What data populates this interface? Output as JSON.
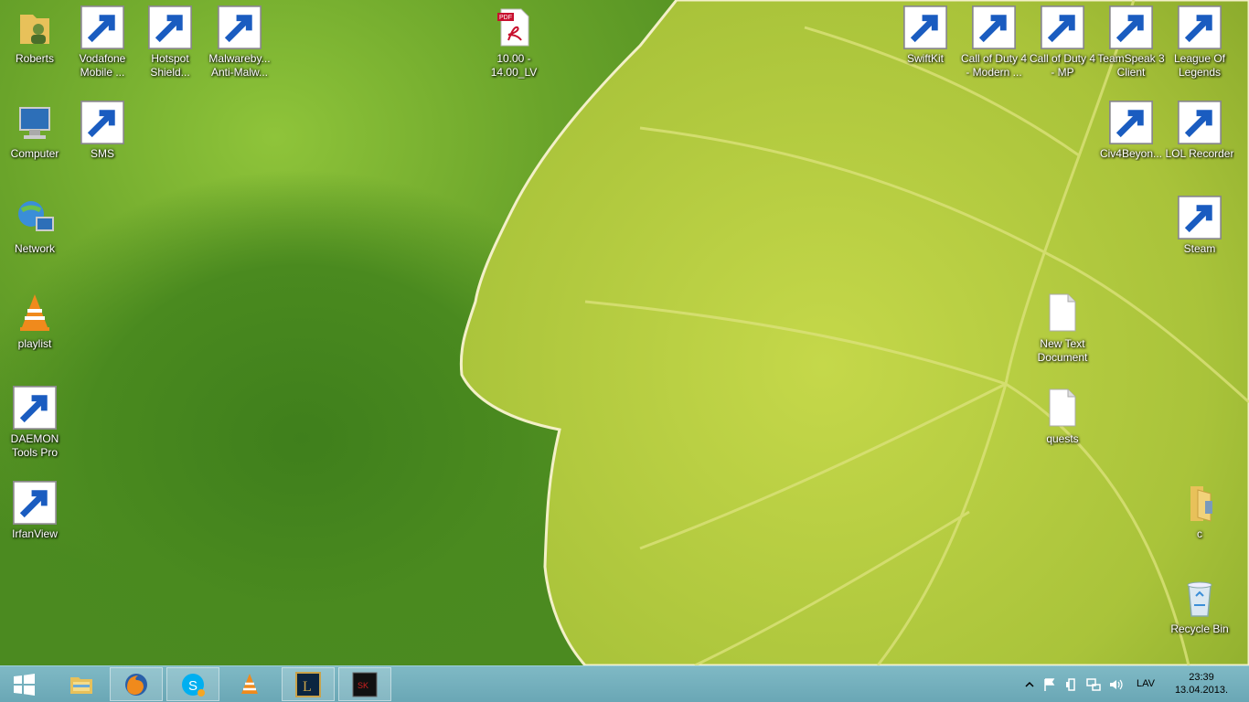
{
  "desktop_icons": [
    {
      "label": "Roberts",
      "icon": "user-folder-icon"
    },
    {
      "label": "Vodafone\nMobile ...",
      "icon": "vodafone-icon"
    },
    {
      "label": "Hotspot\nShield...",
      "icon": "hotspot-shield-icon"
    },
    {
      "label": "Malwareby...\nAnti-Malw...",
      "icon": "malwarebytes-icon"
    },
    {
      "label": "10.00 -\n14.00_LV",
      "icon": "pdf-file-icon"
    },
    {
      "label": "SwiftKit",
      "icon": "swiftkit-icon"
    },
    {
      "label": "Call of Duty 4\n- Modern ...",
      "icon": "cod4-icon"
    },
    {
      "label": "Call of Duty 4\n- MP",
      "icon": "cod4-mp-icon"
    },
    {
      "label": "TeamSpeak 3\nClient",
      "icon": "teamspeak-icon"
    },
    {
      "label": "League Of\nLegends",
      "icon": "league-of-legends-icon"
    },
    {
      "label": "Computer",
      "icon": "computer-icon"
    },
    {
      "label": "SMS",
      "icon": "sms-icon"
    },
    {
      "label": "Civ4Beyon...",
      "icon": "civ4-icon"
    },
    {
      "label": "LOL Recorder",
      "icon": "lol-recorder-icon"
    },
    {
      "label": "Network",
      "icon": "network-icon"
    },
    {
      "label": "Steam",
      "icon": "steam-icon"
    },
    {
      "label": "playlist",
      "icon": "vlc-playlist-icon"
    },
    {
      "label": "New Text\nDocument",
      "icon": "text-document-icon"
    },
    {
      "label": "DAEMON\nTools Pro",
      "icon": "daemon-tools-icon"
    },
    {
      "label": "quests",
      "icon": "text-document-icon"
    },
    {
      "label": "IrfanView",
      "icon": "irfanview-icon"
    },
    {
      "label": "c",
      "icon": "folder-icon"
    },
    {
      "label": "Recycle Bin",
      "icon": "recycle-bin-icon"
    }
  ],
  "taskbar": {
    "buttons": [
      {
        "icon": "start-button-icon",
        "state": "start"
      },
      {
        "icon": "file-explorer-icon",
        "state": "pinned"
      },
      {
        "icon": "firefox-icon",
        "state": "running"
      },
      {
        "icon": "skype-icon",
        "state": "running"
      },
      {
        "icon": "vlc-icon",
        "state": "pinned"
      },
      {
        "icon": "league-of-legends-icon",
        "state": "running"
      },
      {
        "icon": "swiftkit-icon",
        "state": "running"
      }
    ],
    "tray": {
      "icons": [
        "show-hidden-icons-chevron",
        "action-center-flag-icon",
        "power-icon",
        "network-icon",
        "volume-icon"
      ],
      "language": "LAV",
      "time": "23:39",
      "date": "13.04.2013."
    }
  },
  "colors": {
    "taskbar": "#72adbb",
    "wallpaper_green": "#6aa42a",
    "leaf": "#b7cf3f"
  }
}
